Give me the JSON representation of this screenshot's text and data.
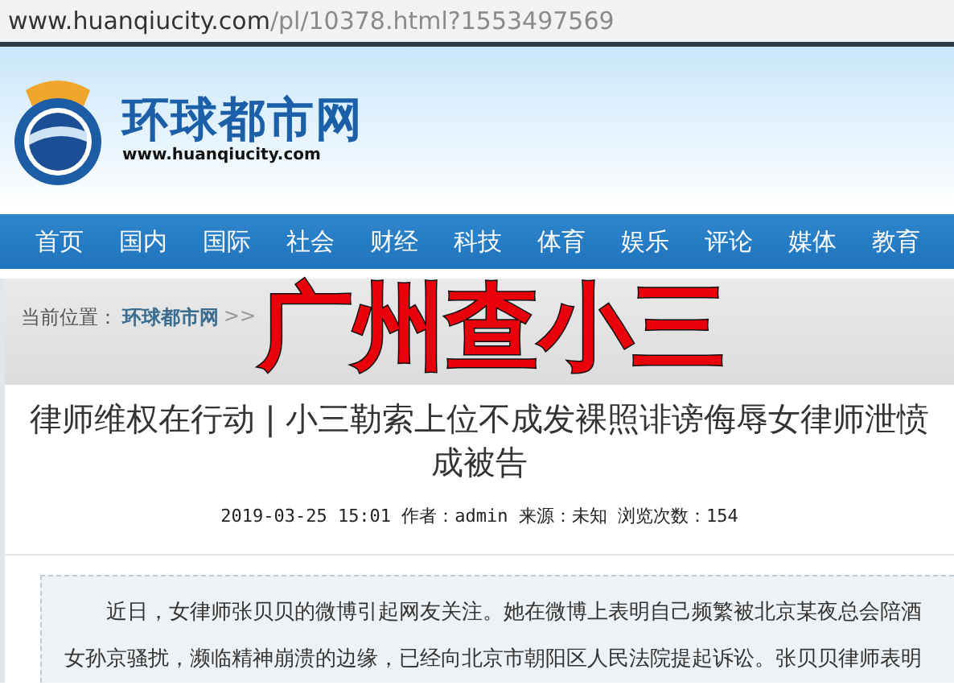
{
  "browser": {
    "url_host": "www.huanqiucity.com",
    "url_path": "/pl/10378.html?1553497569"
  },
  "site": {
    "name": "环球都市网",
    "domain": "www.huanqiucity.com"
  },
  "nav": {
    "items": [
      {
        "label": "首页"
      },
      {
        "label": "国内"
      },
      {
        "label": "国际"
      },
      {
        "label": "社会"
      },
      {
        "label": "财经"
      },
      {
        "label": "科技"
      },
      {
        "label": "体育"
      },
      {
        "label": "娱乐"
      },
      {
        "label": "评论"
      },
      {
        "label": "媒体"
      },
      {
        "label": "教育"
      }
    ]
  },
  "breadcrumb": {
    "label": "当前位置：",
    "link": "环球都市网",
    "separator": ">>"
  },
  "overlay": {
    "text": "广州查小三"
  },
  "article": {
    "title": "律师维权在行动 | 小三勒索上位不成发裸照诽谤侮辱女律师泄愤成被告",
    "meta": "2019-03-25 15:01 作者：admin 来源：未知 浏览次数：154",
    "intro": "近日，女律师张贝贝的微博引起网友关注。她在微博上表明自己频繁被北京某夜总会陪酒女孙京骚扰，濒临精神崩溃的边缘，已经向北京市朝阳区人民法院提起诉讼。张贝贝律师表明"
  }
}
